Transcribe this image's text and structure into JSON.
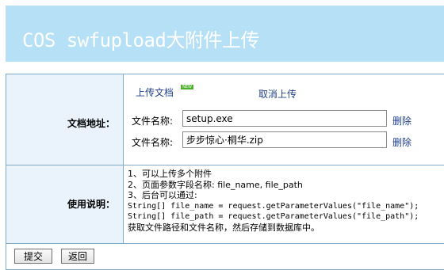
{
  "header": {
    "title": "COS swfupload大附件上传"
  },
  "upload": {
    "label": "文档地址：",
    "upload_link": "上传文档",
    "badge": "NEW",
    "cancel_link": "取消上传",
    "files": [
      {
        "name_label": "文件名称:",
        "value": "setup.exe",
        "delete_label": "删除"
      },
      {
        "name_label": "文件名称:",
        "value": "步步惊心·桐华.zip",
        "delete_label": "删除"
      }
    ]
  },
  "instructions": {
    "label": "使用说明：",
    "lines": [
      "1、可以上传多个附件",
      "2、页面参数字段名称: file_name, file_path",
      "3、后台可以通过:",
      "String[] file_name = request.getParameterValues(\"file_name\");",
      "String[] file_path = request.getParameterValues(\"file_path\");",
      "获取文件路径和文件名称，然后存储到数据库中。"
    ]
  },
  "actions": {
    "submit_label": "提交",
    "back_label": "返回"
  }
}
